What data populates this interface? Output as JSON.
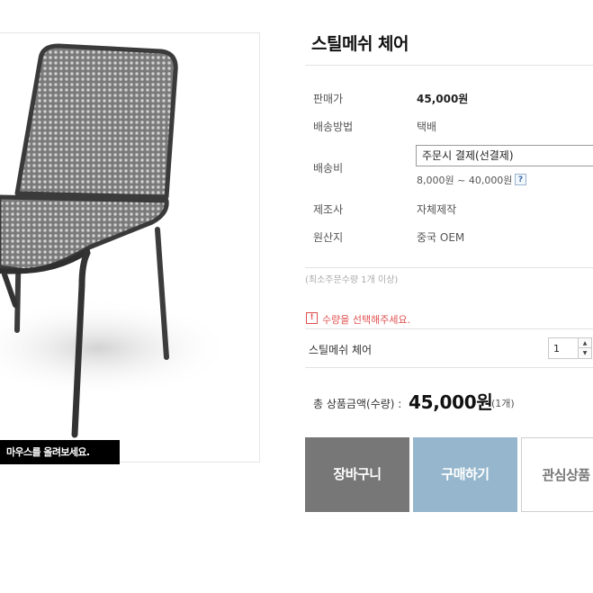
{
  "image": {
    "alt": "steel mesh chair product photo",
    "hover_hint": "마우스를 올려보세요."
  },
  "product": {
    "title": "스틸메쉬 체어",
    "rows": [
      {
        "label": "판매가",
        "value": "45,000원"
      },
      {
        "label": "배송방법",
        "value": "택배"
      },
      {
        "label": "배송비",
        "value": ""
      },
      {
        "label": "제조사",
        "value": "자체제작"
      },
      {
        "label": "원산지",
        "value": "중국 OEM"
      }
    ],
    "shipping_select": "주문시 결제(선결제)",
    "shipping_range": "8,000원 ~ 40,000원",
    "help_icon": "?"
  },
  "order": {
    "min_order": "(최소주문수량 1개 이상)",
    "warn_icon": "!",
    "warning": "수량을 선택해주세요.",
    "option_name": "스틸메쉬 체어",
    "quantity": "1",
    "qty_up": "▲",
    "qty_down": "▼"
  },
  "total": {
    "label": "총 상품금액(수량) :",
    "price": "45,000원",
    "count": "(1개)"
  },
  "buttons": {
    "cart": "장바구니",
    "buy": "구매하기",
    "wish": "관심상품"
  },
  "colors": {
    "cart_bg": "#777777",
    "buy_bg": "#95b6cc",
    "warning": "#e05050"
  }
}
